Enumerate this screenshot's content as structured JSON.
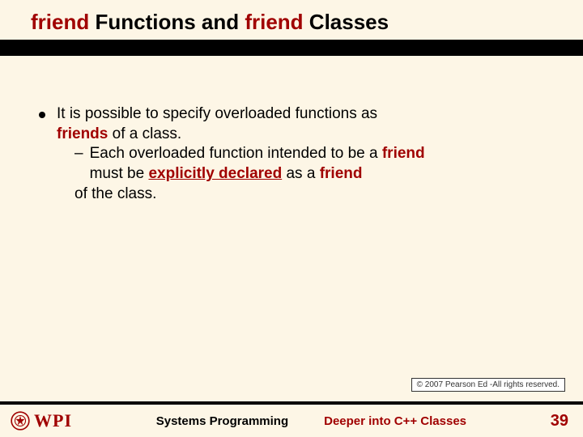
{
  "title": {
    "p1": "friend",
    "p2": " Functions and ",
    "p3": "friend",
    "p4": " Classes"
  },
  "body": {
    "line1a": "It is possible to specify overloaded functions as ",
    "line1_friends": "friends",
    "line1b": " of a class.",
    "sub_a": "Each overloaded function intended to be a ",
    "sub_friend1": "friend",
    "sub_b": "must be ",
    "sub_explicit": "explicitly declared",
    "sub_c": " as a ",
    "sub_friend2": "friend",
    "sub_d": "of the class."
  },
  "copyright": "© 2007 Pearson Ed -All rights reserved.",
  "footer": {
    "logo_text": "WPI",
    "systems": "Systems Programming",
    "deeper": "Deeper into C++ Classes",
    "page": "39"
  }
}
